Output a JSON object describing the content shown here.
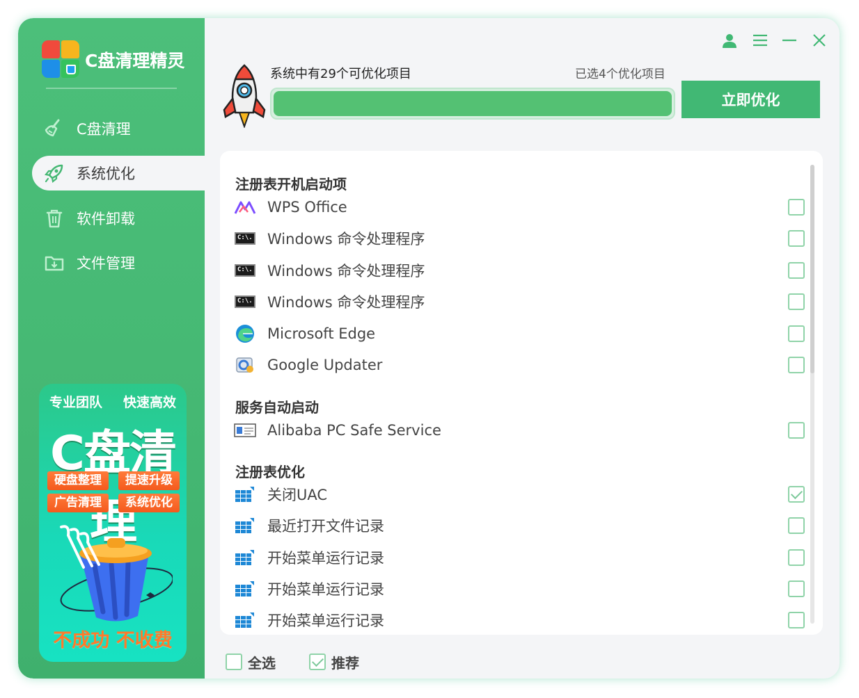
{
  "app": {
    "title": "C盘清理精灵"
  },
  "sidebar": {
    "items": [
      {
        "label": "C盘清理",
        "icon": "broom-icon",
        "active": false
      },
      {
        "label": "系统优化",
        "icon": "rocket-icon",
        "active": true
      },
      {
        "label": "软件卸载",
        "icon": "trash-icon",
        "active": false
      },
      {
        "label": "文件管理",
        "icon": "folder-icon",
        "active": false
      }
    ]
  },
  "ad": {
    "top_left": "专业团队",
    "top_right": "快速高效",
    "headline": "C盘清理",
    "tags": [
      "硬盘整理",
      "提速升级",
      "广告清理",
      "系统优化"
    ],
    "bottom": "不成功 不收费"
  },
  "header": {
    "summary": "系统中有29个可优化项目",
    "selected": "已选4个优化项目",
    "progress": 1.0,
    "optimize_button": "立即优化"
  },
  "window_controls": {
    "user": "user-icon",
    "menu": "menu-icon",
    "minimize": "minimize-icon",
    "close": "close-icon"
  },
  "sections": [
    {
      "title": "注册表开机启动项",
      "items": [
        {
          "label": "WPS Office",
          "icon": "wps-icon",
          "checked": false
        },
        {
          "label": "Windows 命令处理程序",
          "icon": "cmd-icon",
          "checked": false
        },
        {
          "label": "Windows 命令处理程序",
          "icon": "cmd-icon",
          "checked": false
        },
        {
          "label": "Windows 命令处理程序",
          "icon": "cmd-icon",
          "checked": false
        },
        {
          "label": "Microsoft Edge",
          "icon": "edge-icon",
          "checked": false
        },
        {
          "label": "Google Updater",
          "icon": "google-updater-icon",
          "checked": false
        }
      ]
    },
    {
      "title": "服务自动启动",
      "items": [
        {
          "label": "Alibaba PC Safe Service",
          "icon": "service-icon",
          "checked": false
        }
      ]
    },
    {
      "title": "注册表优化",
      "items": [
        {
          "label": "关闭UAC",
          "icon": "registry-icon",
          "checked": true
        },
        {
          "label": "最近打开文件记录",
          "icon": "registry-icon",
          "checked": false
        },
        {
          "label": "开始菜单运行记录",
          "icon": "registry-icon",
          "checked": false
        },
        {
          "label": "开始菜单运行记录",
          "icon": "registry-icon",
          "checked": false
        },
        {
          "label": "开始菜单运行记录",
          "icon": "registry-icon",
          "checked": false
        }
      ]
    }
  ],
  "footer": {
    "select_all": {
      "label": "全选",
      "checked": false
    },
    "recommend": {
      "label": "推荐",
      "checked": true
    }
  }
}
